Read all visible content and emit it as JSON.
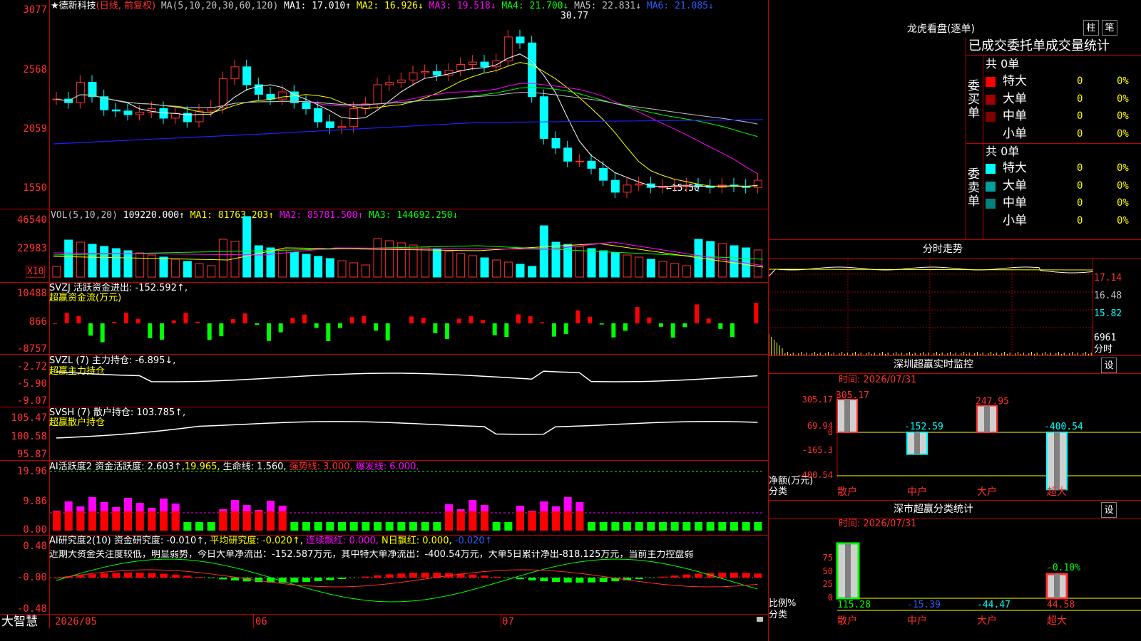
{
  "stock": {
    "name": "德新科技",
    "mode": "(日线, 前复权)"
  },
  "ma_header": {
    "prefix": "MA(5,10,20,30,60,120)",
    "ma1": "MA1: 17.010↑",
    "ma2": "MA2: 16.926↓",
    "ma3": "MA3: 19.518↓",
    "ma4": "MA4: 21.700↓",
    "ma5": "MA5: 22.831↓",
    "ma6": "MA6: 21.085↓"
  },
  "price_axis": [
    "3077",
    "2568",
    "2059",
    "1550"
  ],
  "price_marks": {
    "high": "30.77",
    "low": "←15.50"
  },
  "vol_header": {
    "prefix": "VOL(5,10,20)",
    "vol": "109220.000↑",
    "ma1": "MA1: 81763.203↑",
    "ma2": "MA2: 85781.500↑",
    "ma3": "MA3: 144692.250↓"
  },
  "vol_axis": [
    "46540",
    "22983"
  ],
  "vol_unit": "X10",
  "svzj": {
    "header": "SVZJ  活跃资金进出: -152.592↑,",
    "sub": "超赢资金流(万元)",
    "axis": [
      "10488",
      "866",
      "-8757"
    ]
  },
  "svzl": {
    "header": "SVZL (7) 主力持仓: -6.895↓,",
    "sub": "超赢主力持仓",
    "axis": [
      "-2.72",
      "-5.90",
      "-9.07"
    ]
  },
  "svsh": {
    "header": "SVSH (7) 散户持仓: 103.785↑,",
    "sub": "超赢散户持仓",
    "axis": [
      "105.47",
      "100.58",
      "95.87"
    ]
  },
  "ai_active": {
    "header_a": "AI活跃度2 资金活跃度: 2.603↑,",
    "header_b": "19.965,",
    "header_c": "生命线: 1.560,",
    "header_d": "强势线: 3.000,",
    "header_e": "爆发线: 6.000,",
    "axis": [
      "19.96",
      "9.86",
      "0.00"
    ]
  },
  "ai_research": {
    "header_a": "AI研究度2(10)  资金研究度: -0.010↑,",
    "header_b": "平均研究度: -0.020↑,",
    "header_c": "连续飘红: 0.000,",
    "header_d": "N日飘红: 0.000,",
    "header_e": "-0.020↑",
    "comment": "近期大资金关注度较低，明显弱势，今日大单净流出：-152.587万元，其中特大单净流出：-400.54万元，大单5日累计净出-818.125万元，当前主力控盘弱",
    "axis": [
      "0.48",
      "-0.00",
      "-0.48"
    ]
  },
  "bottom": {
    "brand": "大智慧",
    "dates": [
      "2026/05",
      "06",
      "07"
    ]
  },
  "lhb": {
    "title": "龙虎看盘(逐单)",
    "btn1": "柱",
    "btn2": "笔",
    "subtitle": "已成交委托单成交量统计",
    "buy": {
      "label": "委买单",
      "total": "共 0单",
      "rows": [
        {
          "name": "特大",
          "value": "0",
          "pct": "0%",
          "color": "#ff0000"
        },
        {
          "name": "大单",
          "value": "0",
          "pct": "0%",
          "color": "#a00000"
        },
        {
          "name": "中单",
          "value": "0",
          "pct": "0%",
          "color": "#800000"
        },
        {
          "name": "小单",
          "value": "0",
          "pct": "0%",
          "color": ""
        }
      ]
    },
    "sell": {
      "label": "委卖单",
      "total": "共 0单",
      "rows": [
        {
          "name": "特大",
          "value": "0",
          "pct": "0%",
          "color": "#00ffff"
        },
        {
          "name": "大单",
          "value": "0",
          "pct": "0%",
          "color": "#00a0a0"
        },
        {
          "name": "中单",
          "value": "0",
          "pct": "0%",
          "color": "#008080"
        },
        {
          "name": "小单",
          "value": "0",
          "pct": "0%",
          "color": ""
        }
      ]
    }
  },
  "fenshi": {
    "title": "分时走势",
    "axis": [
      "17.14",
      "16.48",
      "15.82",
      "6961"
    ],
    "unit": "分时"
  },
  "sz_monitor": {
    "title": "深圳超赢实时监控",
    "btn": "设",
    "time": "时间: 2026/07/31",
    "axis": [
      "305.17",
      "69.94",
      "0",
      "-165.3",
      "-400.54"
    ],
    "ylabel_a": "净额(万元)",
    "ylabel_b": "分类",
    "cats": [
      "散户",
      "中户",
      "大户",
      "超大"
    ],
    "values": [
      305.17,
      -152.59,
      247.95,
      -400.54
    ],
    "value_labels": [
      "305.17",
      "-152.59",
      "247.95",
      "-400.54"
    ]
  },
  "sz_class": {
    "title": "深市超赢分类统计",
    "btn": "设",
    "time": "时间: 2026/07/31",
    "axis": [
      "75",
      "50",
      "25",
      "0"
    ],
    "ylabel_a": "比例%",
    "ylabel_b": "分类",
    "cats": [
      "散户",
      "中户",
      "大户",
      "超大"
    ],
    "values": [
      "115.28",
      "-15.39",
      "-44.47",
      "44.58"
    ],
    "top_label": "-0.10%"
  },
  "colors": {
    "up": "#ff3030",
    "down": "#00ffff",
    "border": "#c00000",
    "green": "#00ff00",
    "magenta": "#ff00ff"
  }
}
